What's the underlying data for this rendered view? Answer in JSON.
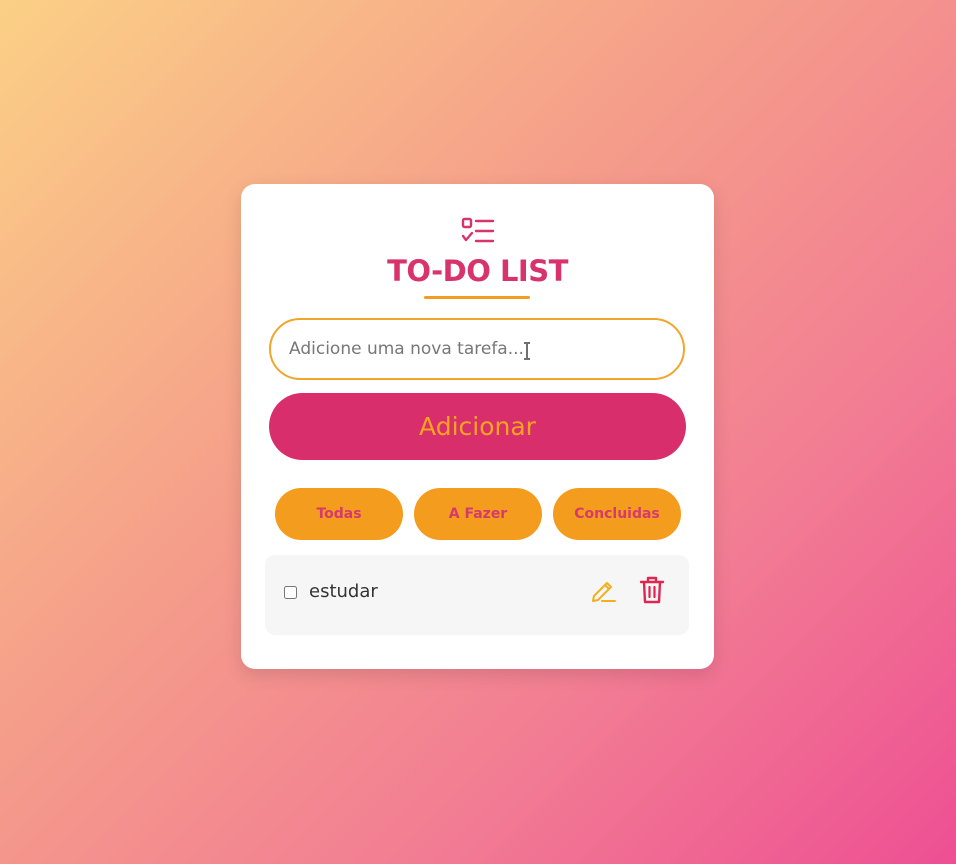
{
  "app": {
    "title": "TO-DO LIST",
    "header_icon": "checklist-icon"
  },
  "input": {
    "placeholder": "Adicione uma nova tarefa..."
  },
  "add_button": {
    "label": "Adicionar"
  },
  "filters": [
    {
      "label": "Todas"
    },
    {
      "label": "A Fazer"
    },
    {
      "label": "Concluidas"
    }
  ],
  "tasks": [
    {
      "text": "estudar",
      "done": false,
      "edit_icon": "pencil-icon",
      "delete_icon": "trash-icon"
    }
  ],
  "colors": {
    "accent_pink": "#d9336b",
    "accent_orange": "#f39c1e"
  }
}
